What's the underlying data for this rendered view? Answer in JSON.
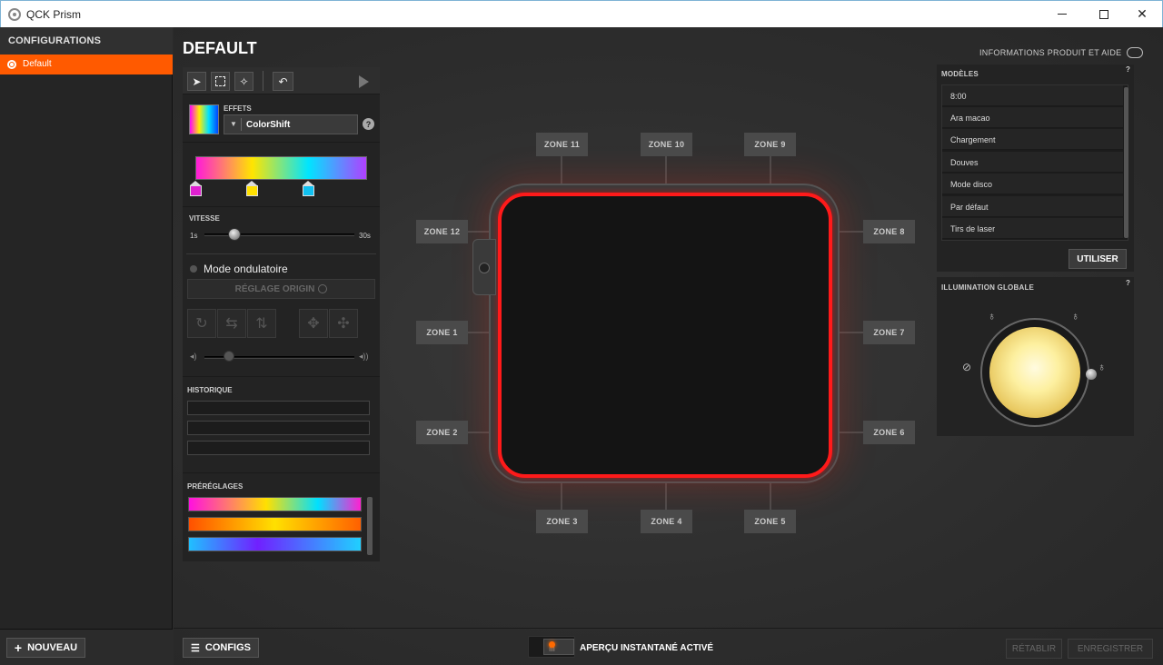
{
  "window": {
    "title": "QCK Prism"
  },
  "sidebar": {
    "header": "CONFIGURATIONS",
    "items": [
      {
        "label": "Default"
      }
    ],
    "new_button": "NOUVEAU"
  },
  "page": {
    "title": "DEFAULT",
    "product_info": "INFORMATIONS PRODUIT ET AIDE"
  },
  "tools": {
    "effects_label": "EFFETS",
    "effect_value": "ColorShift",
    "speed_label": "VITESSE",
    "speed_min": "1s",
    "speed_max": "30s",
    "speed_value_fraction": 0.2,
    "wave_mode_label": "Mode ondulatoire",
    "origin_button": "RÉGLAGE ORIGIN",
    "history_label": "HISTORIQUE",
    "presets_label": "PRÉRÉGLAGES"
  },
  "zones": {
    "zone1": "ZONE 1",
    "zone2": "ZONE 2",
    "zone3": "ZONE 3",
    "zone4": "ZONE 4",
    "zone5": "ZONE 5",
    "zone6": "ZONE 6",
    "zone7": "ZONE 7",
    "zone8": "ZONE 8",
    "zone9": "ZONE 9",
    "zone10": "ZONE 10",
    "zone11": "ZONE 11",
    "zone12": "ZONE 12"
  },
  "models": {
    "label": "MODÈLES",
    "help": "?",
    "items": [
      "8:00",
      "Ara macao",
      "Chargement",
      "Douves",
      "Mode disco",
      "Par défaut",
      "Tirs de laser"
    ],
    "use_button": "UTILISER"
  },
  "illumination": {
    "label": "ILLUMINATION GLOBALE",
    "help": "?"
  },
  "bottom": {
    "configs_button": "CONFIGS",
    "live_preview": "APERÇU INSTANTANÉ ACTIVÉ",
    "reset_button": "RÉTABLIR",
    "save_button": "ENREGISTRER"
  },
  "colors": {
    "accent": "#ff5a00",
    "led_red": "#ff1a1a"
  }
}
